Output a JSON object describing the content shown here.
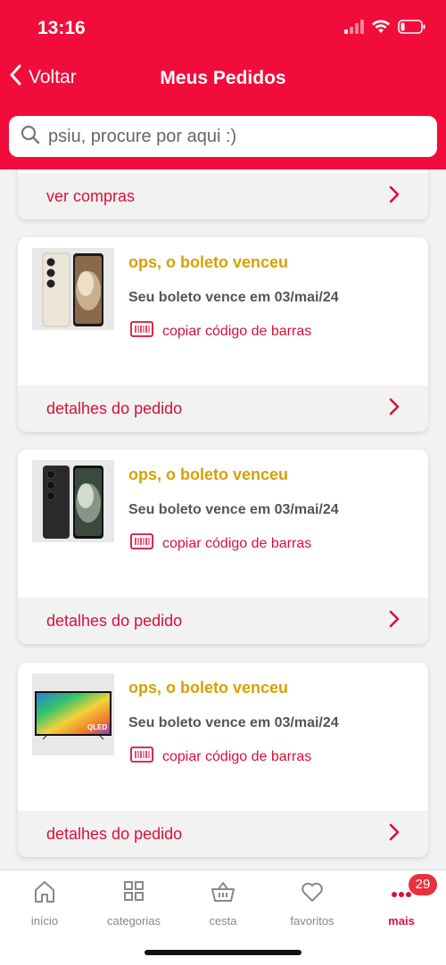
{
  "status_bar": {
    "time": "13:16"
  },
  "header": {
    "back_label": "Voltar",
    "title": "Meus Pedidos",
    "search_placeholder": "psiu, procure por aqui :)"
  },
  "top_card": {
    "footer_label": "ver compras"
  },
  "orders": [
    {
      "product": "smartphone-cream",
      "status": "ops, o boleto venceu",
      "due": "Seu boleto vence em 03/mai/24",
      "copy_label": "copiar código de barras",
      "footer_label": "detalhes do pedido"
    },
    {
      "product": "smartphone-black",
      "status": "ops, o boleto venceu",
      "due": "Seu boleto vence em 03/mai/24",
      "copy_label": "copiar código de barras",
      "footer_label": "detalhes do pedido"
    },
    {
      "product": "qled-tv",
      "status": "ops, o boleto venceu",
      "due": "Seu boleto vence em 03/mai/24",
      "copy_label": "copiar código de barras",
      "footer_label": "detalhes do pedido",
      "tv_logo": "QLED"
    }
  ],
  "bottom_nav": {
    "items": [
      {
        "label": "início",
        "icon": "home-icon"
      },
      {
        "label": "categorias",
        "icon": "grid-icon"
      },
      {
        "label": "cesta",
        "icon": "basket-icon"
      },
      {
        "label": "favoritos",
        "icon": "heart-icon"
      },
      {
        "label": "mais",
        "icon": "more-dots-icon",
        "badge": "29",
        "active": true
      }
    ]
  },
  "colors": {
    "brand_red": "#f20c3c",
    "accent_red": "#d9103a",
    "warning_yellow": "#d6a100"
  }
}
